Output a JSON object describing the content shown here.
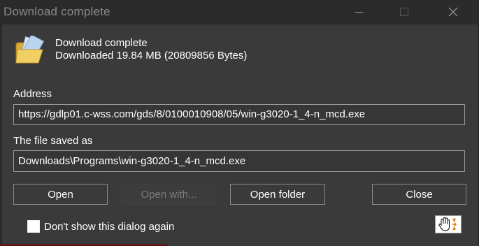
{
  "window": {
    "title": "Download complete",
    "controls": {
      "minimize": "minimize-icon",
      "maximize": "maximize-icon",
      "close": "close-icon"
    }
  },
  "header": {
    "icon": "open-folder-icon",
    "line1": "Download complete",
    "line2": "Downloaded 19.84  MB (20809856 Bytes)"
  },
  "address": {
    "label": "Address",
    "value": "https://gdlp01.c-wss.com/gds/8/0100010908/05/win-g3020-1_4-n_mcd.exe"
  },
  "saved": {
    "label": "The file saved as",
    "value": "Downloads\\Programs\\win-g3020-1_4-n_mcd.exe"
  },
  "buttons": {
    "open": "Open",
    "open_with": "Open with...",
    "open_folder": "Open folder",
    "close": "Close"
  },
  "footer": {
    "checkbox_label": "Don't show this dialog again",
    "checkbox_checked": false,
    "hand_icon": "hand-move-icon"
  },
  "colors": {
    "background": "#2b2b2b",
    "panel": "#3a3a3a",
    "text": "#ffffff",
    "disabled_text": "#7c7c7c",
    "title_text": "#8a8a8a"
  }
}
